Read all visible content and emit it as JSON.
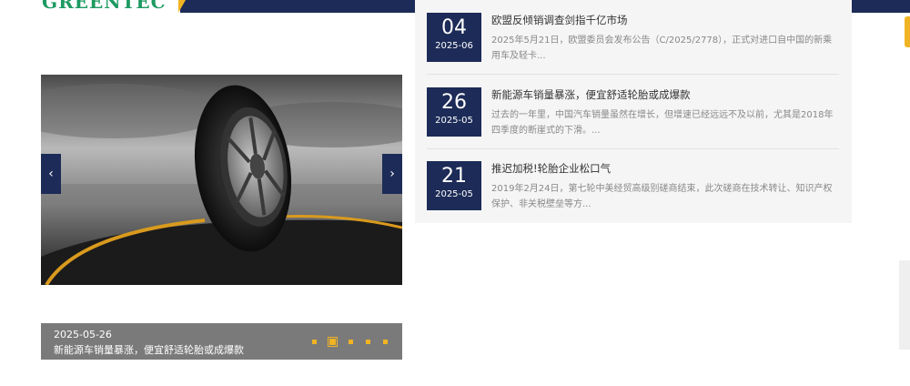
{
  "brand": {
    "logo_text": "GREENTEC",
    "accent": "#f0b323",
    "navy": "#1c2b57",
    "green": "#1d9a62"
  },
  "slider": {
    "prev_icon": "chevron-left-icon",
    "next_icon": "chevron-right-icon",
    "prev_glyph": "‹",
    "next_glyph": "›",
    "caption_date": "2025-05-26",
    "caption_title": "新能源车销量暴涨，便宜舒适轮胎或成爆款",
    "dot_count": 5,
    "active_dot": 2
  },
  "news": [
    {
      "day": "04",
      "ym": "2025-06",
      "title": "欧盟反倾销调查剑指千亿市场",
      "excerpt": "2025年5月21日，欧盟委员会发布公告（C/2025/2778），正式对进口自中国的新乘用车及轻卡..."
    },
    {
      "day": "26",
      "ym": "2025-05",
      "title": "新能源车销量暴涨，便宜舒适轮胎或成爆款",
      "excerpt": "过去的一年里，中国汽车销量虽然在增长，但增速已经远远不及以前，尤其是2018年四季度的断崖式的下滑。..."
    },
    {
      "day": "21",
      "ym": "2025-05",
      "title": "推迟加税!轮胎企业松口气",
      "excerpt": "2019年2月24日，第七轮中美经贸高级别磋商结束，此次磋商在技术转让、知识产权保护、非关税壁垒等方..."
    }
  ]
}
